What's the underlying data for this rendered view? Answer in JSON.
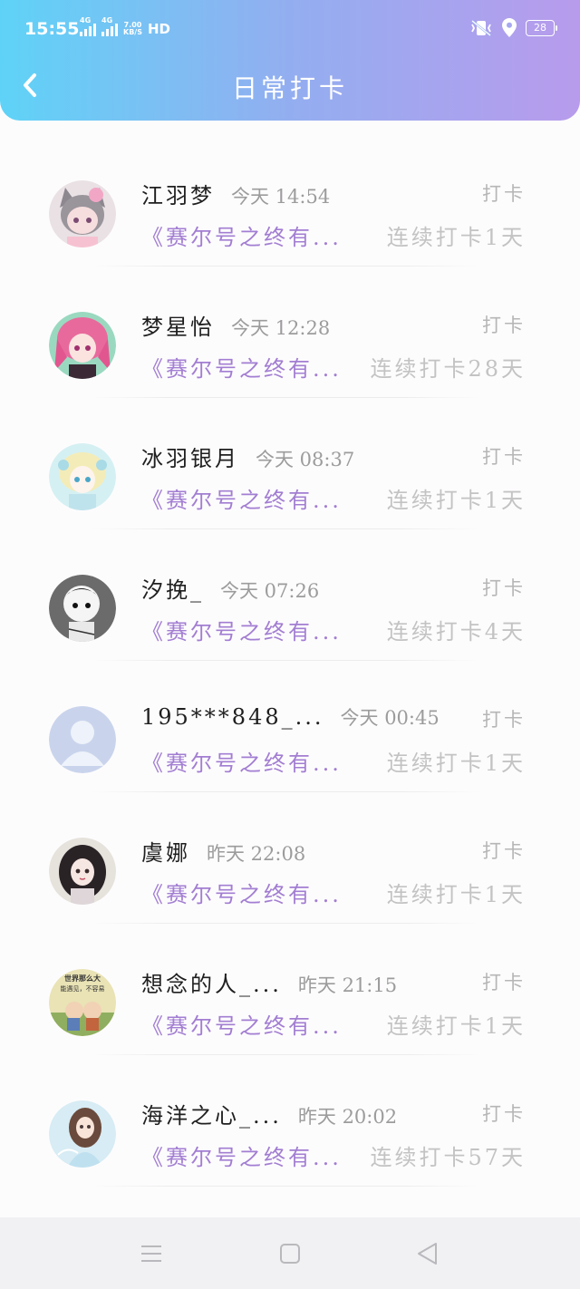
{
  "status_bar": {
    "time": "15:55",
    "signal_1_label": "4G",
    "signal_2_label": "4G",
    "speed_value": "7.00",
    "speed_unit": "KB/S",
    "hd_label": "HD",
    "battery": "28"
  },
  "header": {
    "title": "日常打卡",
    "back_icon": "chevron-left-icon",
    "gradient_start": "#5fd3f7",
    "gradient_end": "#b89bec"
  },
  "colors": {
    "book_accent": "#a27ed2",
    "muted_text": "#b6b6b6"
  },
  "checkins": [
    {
      "name": "江羽梦",
      "time": "今天 14:54",
      "label": "打卡",
      "book": "《赛尔号之终有...",
      "streak": "连续打卡1天"
    },
    {
      "name": "梦星怡",
      "time": "今天 12:28",
      "label": "打卡",
      "book": "《赛尔号之终有...",
      "streak": "连续打卡28天"
    },
    {
      "name": "冰羽银月",
      "time": "今天 08:37",
      "label": "打卡",
      "book": "《赛尔号之终有...",
      "streak": "连续打卡1天"
    },
    {
      "name": "汐挽_",
      "time": "今天 07:26",
      "label": "打卡",
      "book": "《赛尔号之终有...",
      "streak": "连续打卡4天"
    },
    {
      "name": "195***848_...",
      "time": "今天 00:45",
      "label": "打卡",
      "book": "《赛尔号之终有...",
      "streak": "连续打卡1天"
    },
    {
      "name": "虞娜",
      "time": "昨天 22:08",
      "label": "打卡",
      "book": "《赛尔号之终有...",
      "streak": "连续打卡1天"
    },
    {
      "name": "想念的人_...",
      "time": "昨天 21:15",
      "label": "打卡",
      "book": "《赛尔号之终有...",
      "streak": "连续打卡1天"
    },
    {
      "name": "海洋之心_...",
      "time": "昨天 20:02",
      "label": "打卡",
      "book": "《赛尔号之终有...",
      "streak": "连续打卡57天"
    }
  ],
  "avatar_badge": {
    "line1": "世界那么大",
    "line2": "能遇见，不容易"
  },
  "navbar": {
    "menu_icon": "menu-icon",
    "home_icon": "square-home-icon",
    "back_icon": "triangle-back-icon"
  }
}
